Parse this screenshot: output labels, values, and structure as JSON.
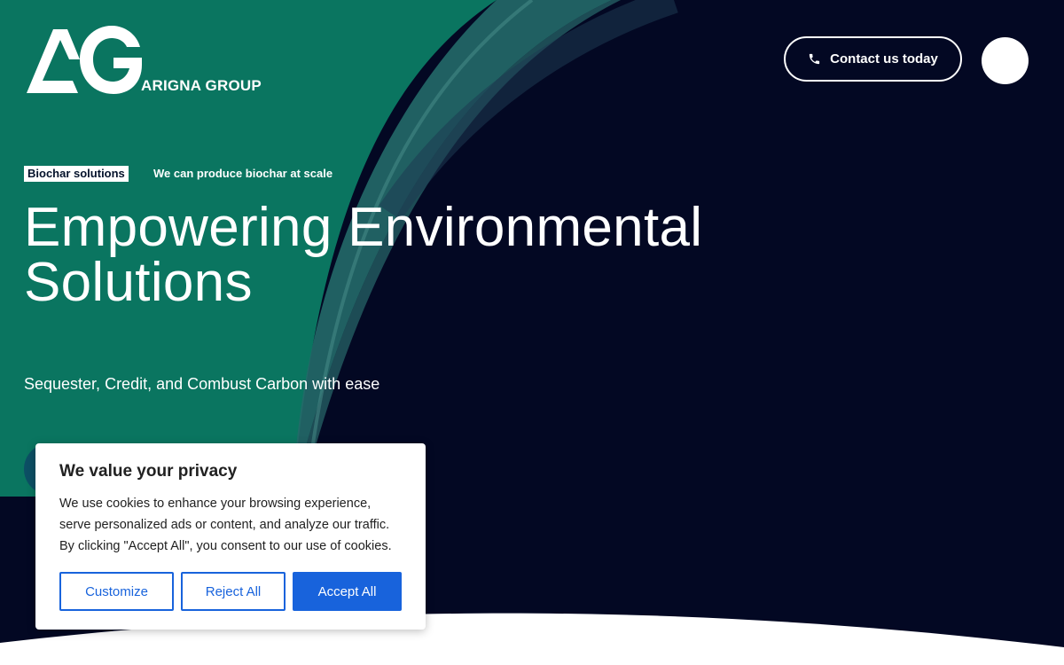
{
  "brand": {
    "logo_letters": "AG",
    "name": "ARIGNA GROUP"
  },
  "header": {
    "contact_label": "Contact us today",
    "contact_icon": "phone-icon",
    "menu_icon": "menu-circle-icon"
  },
  "hero": {
    "tag": "Biochar solutions",
    "tagline": "We can produce biochar at scale",
    "title_line1": "Empowering Environmental",
    "title_line2": "Solutions",
    "subtitle": "Sequester, Credit, and Combust Carbon with ease"
  },
  "cookie_banner": {
    "title": "We value your privacy",
    "body": "We use cookies to enhance your browsing experience, serve personalized ads or content, and analyze our traffic. By clicking \"Accept All\", you consent to our use of cookies.",
    "customize_label": "Customize",
    "reject_label": "Reject All",
    "accept_label": "Accept All"
  },
  "colors": {
    "background_navy": "#030823",
    "teal": "#0a7560",
    "accent_blue": "#1863dc",
    "white": "#ffffff"
  }
}
